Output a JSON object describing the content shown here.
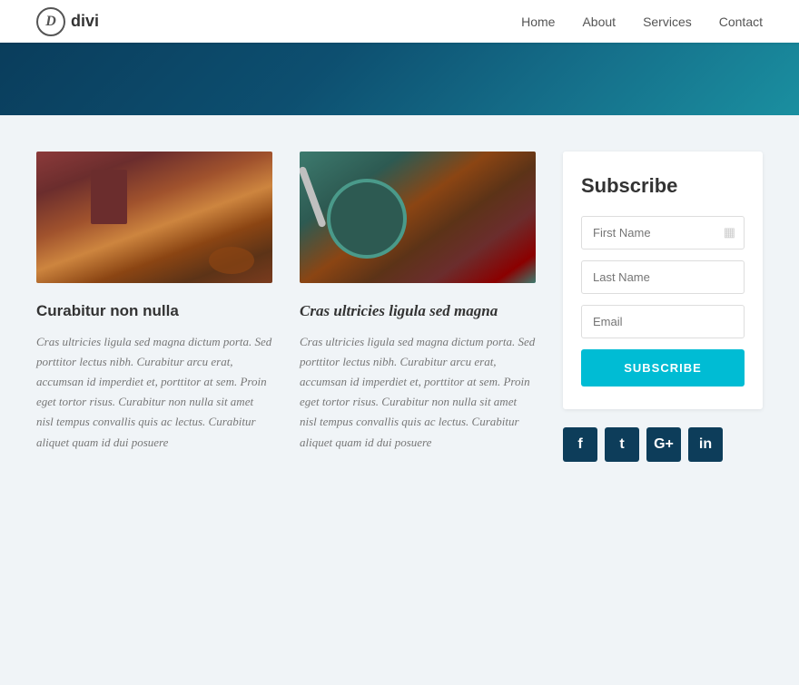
{
  "nav": {
    "logo_letter": "D",
    "logo_name": "divi",
    "links": [
      {
        "label": "Home",
        "id": "home"
      },
      {
        "label": "About",
        "id": "about"
      },
      {
        "label": "Services",
        "id": "services"
      },
      {
        "label": "Contact",
        "id": "contact"
      }
    ]
  },
  "posts": [
    {
      "id": "post-1",
      "image_type": "kitchen",
      "title": "Curabitur non nulla",
      "title_style": "normal",
      "excerpt": "Cras ultricies ligula sed magna dictum porta. Sed porttitor lectus nibh. Curabitur arcu erat, accumsan id imperdiet et, porttitor at sem. Proin eget tortor risus. Curabitur non nulla sit amet nisl tempus convallis quis ac lectus. Curabitur aliquet quam id dui posuere"
    },
    {
      "id": "post-2",
      "image_type": "food",
      "title": "Cras ultricies ligula sed magna",
      "title_style": "italic",
      "excerpt": "Cras ultricies ligula sed magna dictum porta. Sed porttitor lectus nibh. Curabitur arcu erat, accumsan id imperdiet et, porttitor at sem. Proin eget tortor risus. Curabitur non nulla sit amet nisl tempus convallis quis ac lectus. Curabitur aliquet quam id dui posuere"
    }
  ],
  "sidebar": {
    "subscribe": {
      "title": "Subscribe",
      "first_name_placeholder": "First Name",
      "last_name_placeholder": "Last Name",
      "email_placeholder": "Email",
      "button_label": "SUBSCRIBE"
    },
    "social": [
      {
        "id": "facebook",
        "symbol": "f"
      },
      {
        "id": "twitter",
        "symbol": "t"
      },
      {
        "id": "googleplus",
        "symbol": "G+"
      },
      {
        "id": "linkedin",
        "symbol": "in"
      }
    ]
  }
}
